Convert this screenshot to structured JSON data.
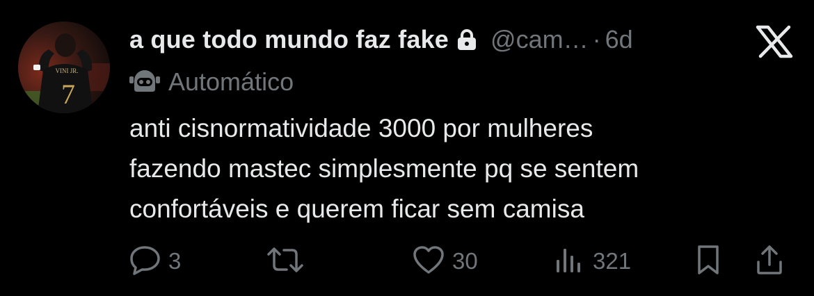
{
  "tweet": {
    "display_name": "a que todo mundo faz fake",
    "handle": "@cam…",
    "separator": "·",
    "time": "6d",
    "automated_label": "Automático",
    "text_lines": [
      "anti cisnormatividade 3000 por mulheres",
      "fazendo mastec simplesmente pq se sentem",
      "confortáveis e querem ficar sem camisa"
    ],
    "avatar_jersey_text": "VINI JR.",
    "avatar_jersey_number": "7"
  },
  "actions": {
    "replies": "3",
    "reposts": "",
    "likes": "30",
    "views": "321"
  },
  "icons": {
    "lock": "lock-icon",
    "automated": "robot-icon",
    "brand": "x-logo-icon",
    "reply": "reply-icon",
    "repost": "repost-icon",
    "like": "heart-icon",
    "views": "views-icon",
    "bookmark": "bookmark-icon",
    "share": "share-icon"
  },
  "colors": {
    "background": "#000000",
    "primary_text": "#e7e9ea",
    "secondary_text": "#71767b"
  }
}
